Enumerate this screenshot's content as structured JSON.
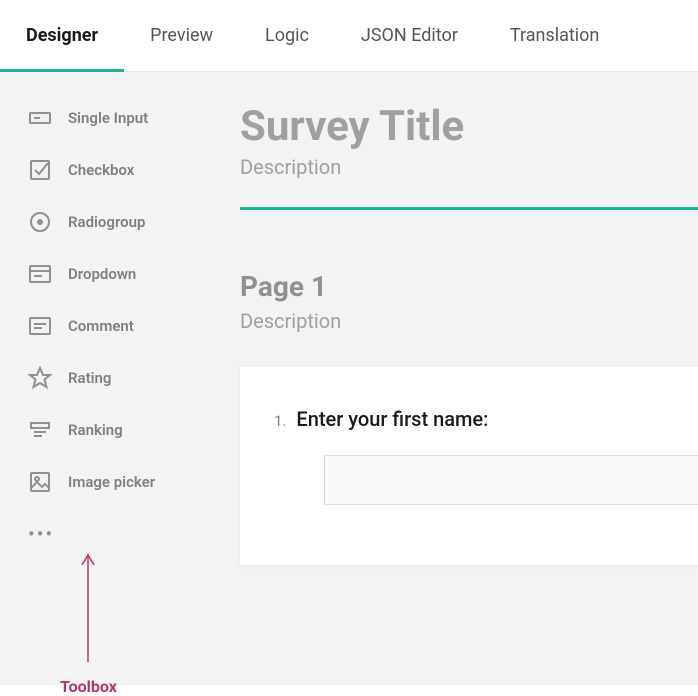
{
  "tabs": [
    {
      "label": "Designer",
      "active": true
    },
    {
      "label": "Preview"
    },
    {
      "label": "Logic"
    },
    {
      "label": "JSON Editor"
    },
    {
      "label": "Translation"
    }
  ],
  "toolbox": {
    "items": [
      {
        "label": "Single Input",
        "icon": "single-input-icon"
      },
      {
        "label": "Checkbox",
        "icon": "checkbox-icon"
      },
      {
        "label": "Radiogroup",
        "icon": "radiogroup-icon"
      },
      {
        "label": "Dropdown",
        "icon": "dropdown-icon"
      },
      {
        "label": "Comment",
        "icon": "comment-icon"
      },
      {
        "label": "Rating",
        "icon": "rating-icon"
      },
      {
        "label": "Ranking",
        "icon": "ranking-icon"
      },
      {
        "label": "Image picker",
        "icon": "image-picker-icon"
      }
    ],
    "more": "•••"
  },
  "survey": {
    "title": "Survey Title",
    "description": "Description"
  },
  "page": {
    "title": "Page 1",
    "description": "Description"
  },
  "question": {
    "number": "1.",
    "text": "Enter your first name:",
    "value": ""
  },
  "annotation": {
    "label": "Toolbox"
  },
  "colors": {
    "accent": "#19b394",
    "annotation": "#b5385e"
  }
}
